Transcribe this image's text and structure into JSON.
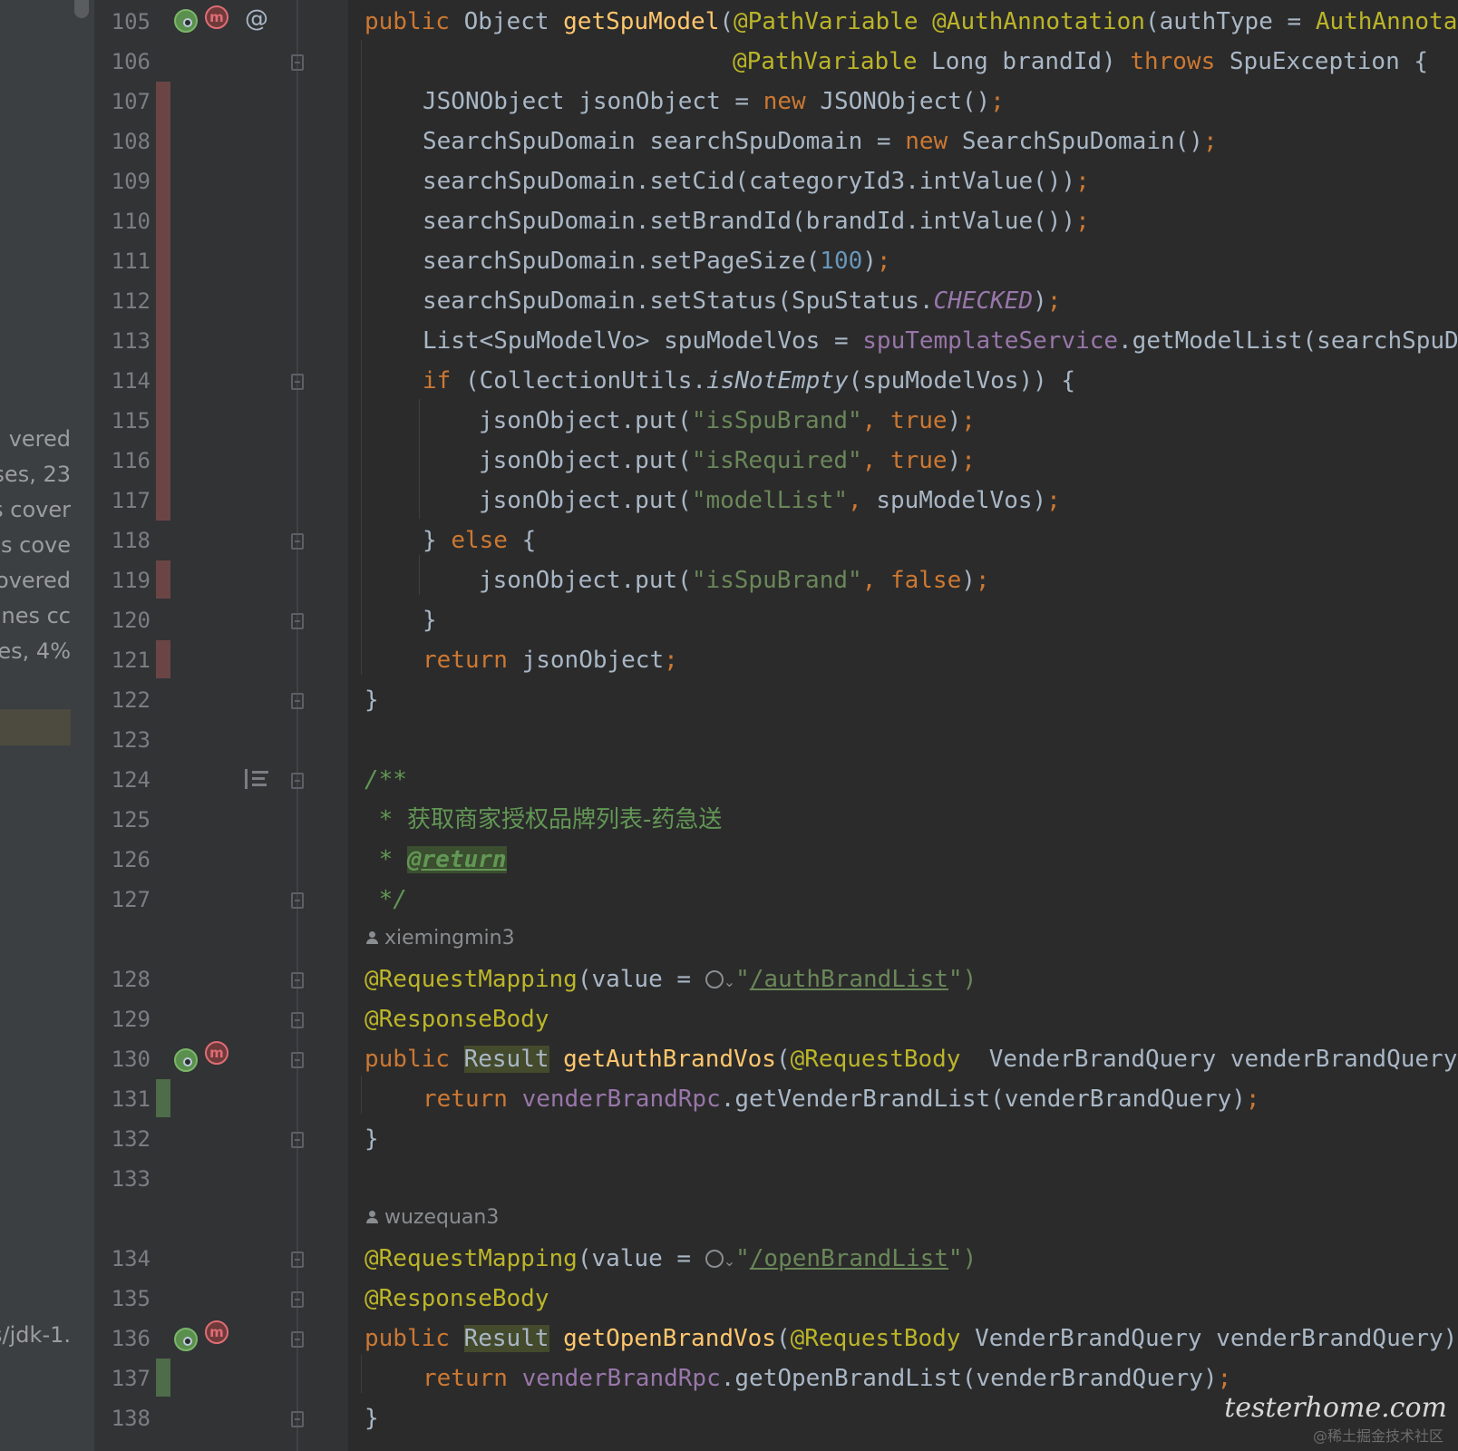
{
  "coverage_panel": {
    "lines": [
      "vered",
      "ses, 23",
      "s cover",
      "es cove",
      "covered",
      "ines cc",
      "es, 4%"
    ],
    "path": "s/jdk-1."
  },
  "editor": {
    "line_numbers": [
      "105",
      "106",
      "107",
      "108",
      "109",
      "110",
      "111",
      "112",
      "113",
      "114",
      "115",
      "116",
      "117",
      "118",
      "119",
      "120",
      "121",
      "122",
      "123",
      "124",
      "125",
      "126",
      "127",
      "128",
      "129",
      "130",
      "131",
      "132",
      "133",
      "134",
      "135",
      "136",
      "137",
      "138"
    ],
    "authors": [
      "xiemingmin3",
      "wuzequan3"
    ],
    "code": {
      "l105": [
        "public ",
        "Object ",
        "getSpuModel",
        "(",
        "@PathVariable ",
        "@AuthAnnotation",
        "(authType = ",
        "AuthAnnotat"
      ],
      "l106": [
        "@PathVariable ",
        "Long brandId) ",
        "throws ",
        "SpuException {"
      ],
      "l107": [
        "JSONObject jsonObject = ",
        "new ",
        "JSONObject()",
        ";"
      ],
      "l108": [
        "SearchSpuDomain searchSpuDomain = ",
        "new ",
        "SearchSpuDomain()",
        ";"
      ],
      "l109": [
        "searchSpuDomain.setCid(categoryId3.intValue())",
        ";"
      ],
      "l110": [
        "searchSpuDomain.setBrandId(brandId.intValue())",
        ";"
      ],
      "l111": [
        "searchSpuDomain.setPageSize(",
        "100",
        ")",
        ";"
      ],
      "l112": [
        "searchSpuDomain.setStatus(SpuStatus.",
        "CHECKED",
        ")",
        ";"
      ],
      "l113": [
        "List<SpuModelVo> spuModelVos = ",
        "spuTemplateService",
        ".getModelList(searchSpuDo"
      ],
      "l114": [
        "if ",
        "(CollectionUtils.",
        "isNotEmpty",
        "(spuModelVos)) {"
      ],
      "l115": [
        "jsonObject.put(",
        "\"isSpuBrand\"",
        ", ",
        "true",
        ")",
        ";"
      ],
      "l116": [
        "jsonObject.put(",
        "\"isRequired\"",
        ", ",
        "true",
        ")",
        ";"
      ],
      "l117": [
        "jsonObject.put(",
        "\"modelList\"",
        ", ",
        "spuModelVos)",
        ";"
      ],
      "l118": [
        "} ",
        "else ",
        "{"
      ],
      "l119": [
        "jsonObject.put(",
        "\"isSpuBrand\"",
        ", ",
        "false",
        ")",
        ";"
      ],
      "l120": [
        "}"
      ],
      "l121": [
        "return ",
        "jsonObject",
        ";"
      ],
      "l122": [
        "}"
      ],
      "l124": [
        "/**"
      ],
      "l125": [
        " * ",
        "获取商家授权品牌列表-药急送"
      ],
      "l126": [
        " * ",
        "@return"
      ],
      "l127": [
        " */"
      ],
      "l128": [
        "@RequestMapping",
        "(value = ",
        "\"",
        "/authBrandList",
        "\")"
      ],
      "l129": [
        "@ResponseBody"
      ],
      "l130": [
        "public ",
        "Result",
        " ",
        "getAuthBrandVos",
        "(",
        "@RequestBody  ",
        "VenderBrandQuery venderBrandQuery)"
      ],
      "l131": [
        "return ",
        "venderBrandRpc",
        ".getVenderBrandList(venderBrandQuery)",
        ";"
      ],
      "l132": [
        "}"
      ],
      "l134": [
        "@RequestMapping",
        "(value = ",
        "\"",
        "/openBrandList",
        "\")"
      ],
      "l135": [
        "@ResponseBody"
      ],
      "l136": [
        "public ",
        "Result",
        " ",
        "getOpenBrandVos",
        "(",
        "@RequestBody ",
        "VenderBrandQuery venderBrandQuery)"
      ],
      "l137": [
        "return ",
        "venderBrandRpc",
        ".getOpenBrandList(venderBrandQuery)",
        ";"
      ],
      "l138": [
        "}"
      ]
    },
    "gutter_icons": {
      "at_symbol": "@",
      "mapper_letter": "m"
    },
    "colors": {
      "background": "#2b2b2b",
      "keyword": "#cc7832",
      "annotation": "#bbb529",
      "string": "#6a8759",
      "number": "#6897bb",
      "method": "#ffc66d",
      "field": "#9876aa",
      "comment": "#629755",
      "coverage_uncovered": "#6b4545",
      "coverage_covered": "#4e6b4a"
    }
  },
  "watermark": {
    "logo": "testerhome.com",
    "credit": "@稀土掘金技术社区"
  }
}
